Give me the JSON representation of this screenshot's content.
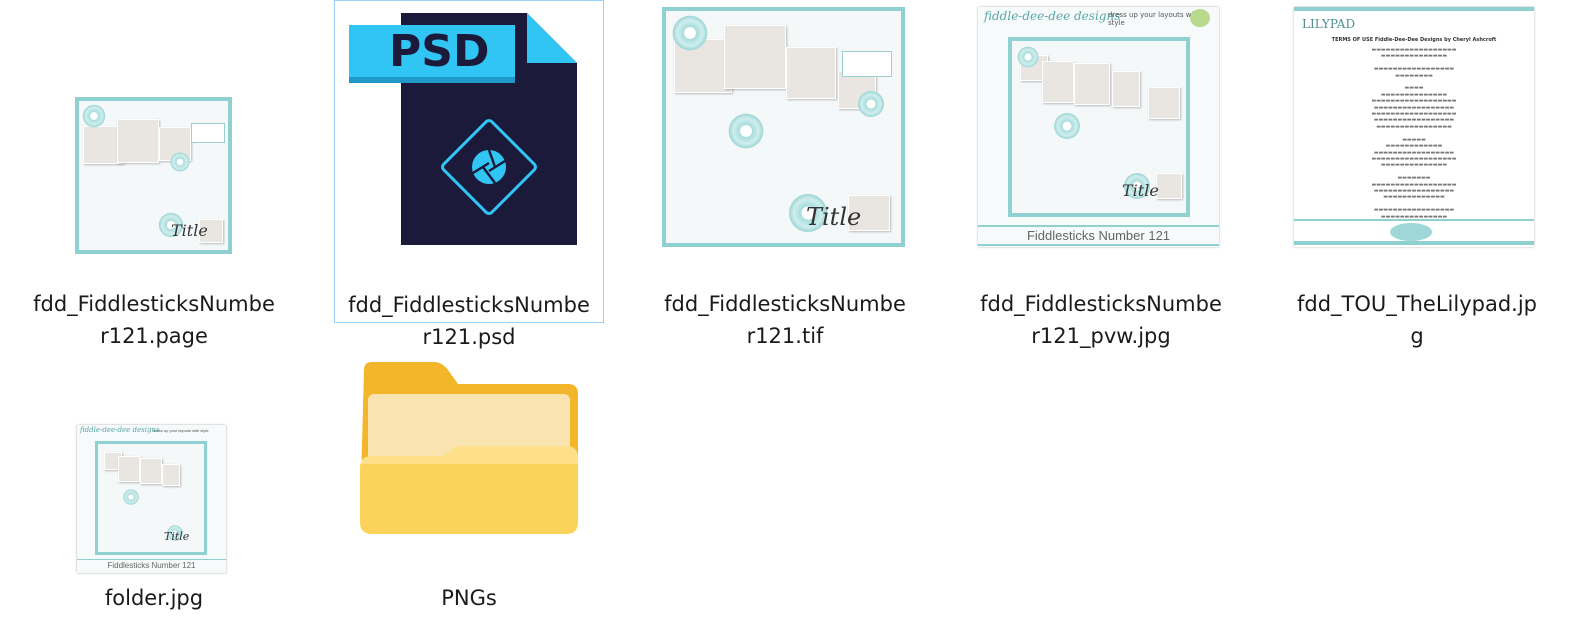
{
  "files": [
    {
      "name": "fdd_FiddlesticksNumber121.page",
      "label_line1": "fdd_FiddlesticksNumbe",
      "label_line2": "r121.page",
      "title": "Title"
    },
    {
      "name": "fdd_FiddlesticksNumber121.psd",
      "label_line1": "fdd_FiddlesticksNumbe",
      "label_line2": "r121.psd",
      "badge": "PSD",
      "selected": true
    },
    {
      "name": "fdd_FiddlesticksNumber121.tif",
      "label_line1": "fdd_FiddlesticksNumbe",
      "label_line2": "r121.tif",
      "title": "Title"
    },
    {
      "name": "fdd_FiddlesticksNumber121_pvw.jpg",
      "label_line1": "fdd_FiddlesticksNumbe",
      "label_line2": "r121_pvw.jpg",
      "brand": "fiddle-dee-dee designs",
      "tagline": "dress up your layouts with style",
      "caption": "Fiddlesticks Number 121",
      "title": "Title"
    },
    {
      "name": "fdd_TOU_TheLilypad.jpg",
      "label_line1": "fdd_TOU_TheLilypad.jp",
      "label_line2": "g",
      "logo": "LILYPAD",
      "heading": "TERMS OF USE  Fiddle-Dee-Dee Designs by Cheryl Ashcroft"
    },
    {
      "name": "folder.jpg",
      "label_line1": "folder.jpg",
      "brand": "fiddle-dee-dee designs",
      "tagline": "dress up your layouts with style",
      "caption": "Fiddlesticks Number 121",
      "title": "Title"
    },
    {
      "name": "PNGs",
      "label_line1": "PNGs",
      "type": "folder"
    }
  ],
  "colors": {
    "teal": "#8fd0d0",
    "selection_border": "#99d1ff",
    "psd_blue": "#31c5f4",
    "psd_dark": "#1b1a3b",
    "folder_yellow": "#f8c43d"
  }
}
